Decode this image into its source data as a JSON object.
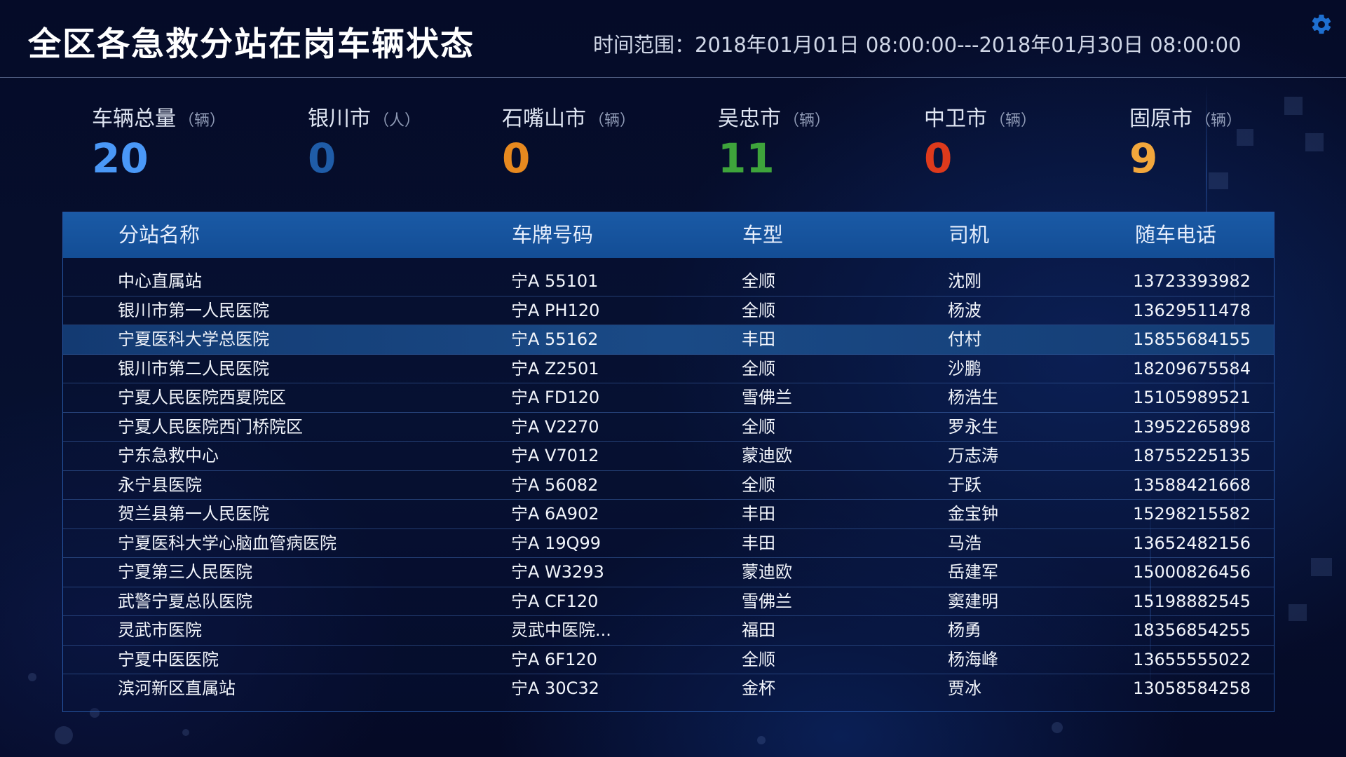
{
  "header": {
    "title": "全区各急救分站在岗车辆状态",
    "time_range": "时间范围：2018年01月01日 08:00:00---2018年01月30日 08:00:00",
    "settings_icon": "gear-icon"
  },
  "stats": [
    {
      "label": "车辆总量",
      "unit": "（辆）",
      "value": "20",
      "color": "#4a98f7"
    },
    {
      "label": "银川市",
      "unit": "（人）",
      "value": "0",
      "color": "#1f5ca8"
    },
    {
      "label": "石嘴山市",
      "unit": "（辆）",
      "value": "0",
      "color": "#e7891f"
    },
    {
      "label": "吴忠市",
      "unit": "（辆）",
      "value": "11",
      "color": "#3ea43b"
    },
    {
      "label": "中卫市",
      "unit": "（辆）",
      "value": "0",
      "color": "#de3a1c"
    },
    {
      "label": "固原市",
      "unit": "（辆）",
      "value": "9",
      "color": "#f2a73c"
    }
  ],
  "table": {
    "columns": [
      "分站名称",
      "车牌号码",
      "车型",
      "司机",
      "随车电话"
    ],
    "selected_row": 2,
    "rows": [
      [
        "中心直属站",
        "宁A 55101",
        "全顺",
        "沈刚",
        "13723393982"
      ],
      [
        "银川市第一人民医院",
        "宁A PH120",
        "全顺",
        "杨波",
        "13629511478"
      ],
      [
        "宁夏医科大学总医院",
        "宁A 55162",
        "丰田",
        "付村",
        "15855684155"
      ],
      [
        "银川市第二人民医院",
        "宁A Z2501",
        "全顺",
        "沙鹏",
        "18209675584"
      ],
      [
        "宁夏人民医院西夏院区",
        "宁A FD120",
        "雪佛兰",
        "杨浩生",
        "15105989521"
      ],
      [
        "宁夏人民医院西门桥院区",
        "宁A V2270",
        "全顺",
        "罗永生",
        "13952265898"
      ],
      [
        "宁东急救中心",
        "宁A V7012",
        "蒙迪欧",
        "万志涛",
        "18755225135"
      ],
      [
        "永宁县医院",
        "宁A 56082",
        "全顺",
        "于跃",
        "13588421668"
      ],
      [
        "贺兰县第一人民医院",
        "宁A 6A902",
        "丰田",
        "金宝钟",
        "15298215582"
      ],
      [
        "宁夏医科大学心脑血管病医院",
        "宁A 19Q99",
        "丰田",
        "马浩",
        "13652482156"
      ],
      [
        "宁夏第三人民医院",
        "宁A W3293",
        "蒙迪欧",
        "岳建军",
        "15000826456"
      ],
      [
        "武警宁夏总队医院",
        "宁A CF120",
        "雪佛兰",
        "窦建明",
        "15198882545"
      ],
      [
        "灵武市医院",
        "灵武中医院...",
        "福田",
        "杨勇",
        "18356854255"
      ],
      [
        "宁夏中医医院",
        "宁A 6F120",
        "全顺",
        "杨海峰",
        "13655555022"
      ],
      [
        "滨河新区直属站",
        "宁A 30C32",
        "金杯",
        "贾冰",
        "13058584258"
      ]
    ]
  }
}
